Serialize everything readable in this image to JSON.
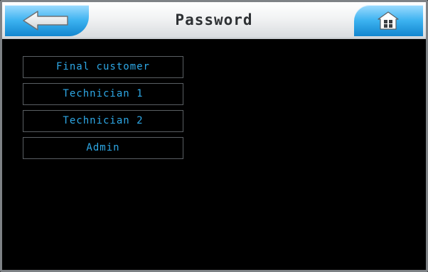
{
  "header": {
    "title": "Password",
    "back_icon": "back-arrow-icon",
    "home_icon": "home-icon"
  },
  "menu": {
    "items": [
      {
        "label": "Final customer"
      },
      {
        "label": "Technician 1"
      },
      {
        "label": "Technician 2"
      },
      {
        "label": "Admin"
      }
    ]
  },
  "colors": {
    "accent_blue": "#2ea8e6",
    "header_button_blue": "#3cb2f0",
    "background": "#000000"
  }
}
